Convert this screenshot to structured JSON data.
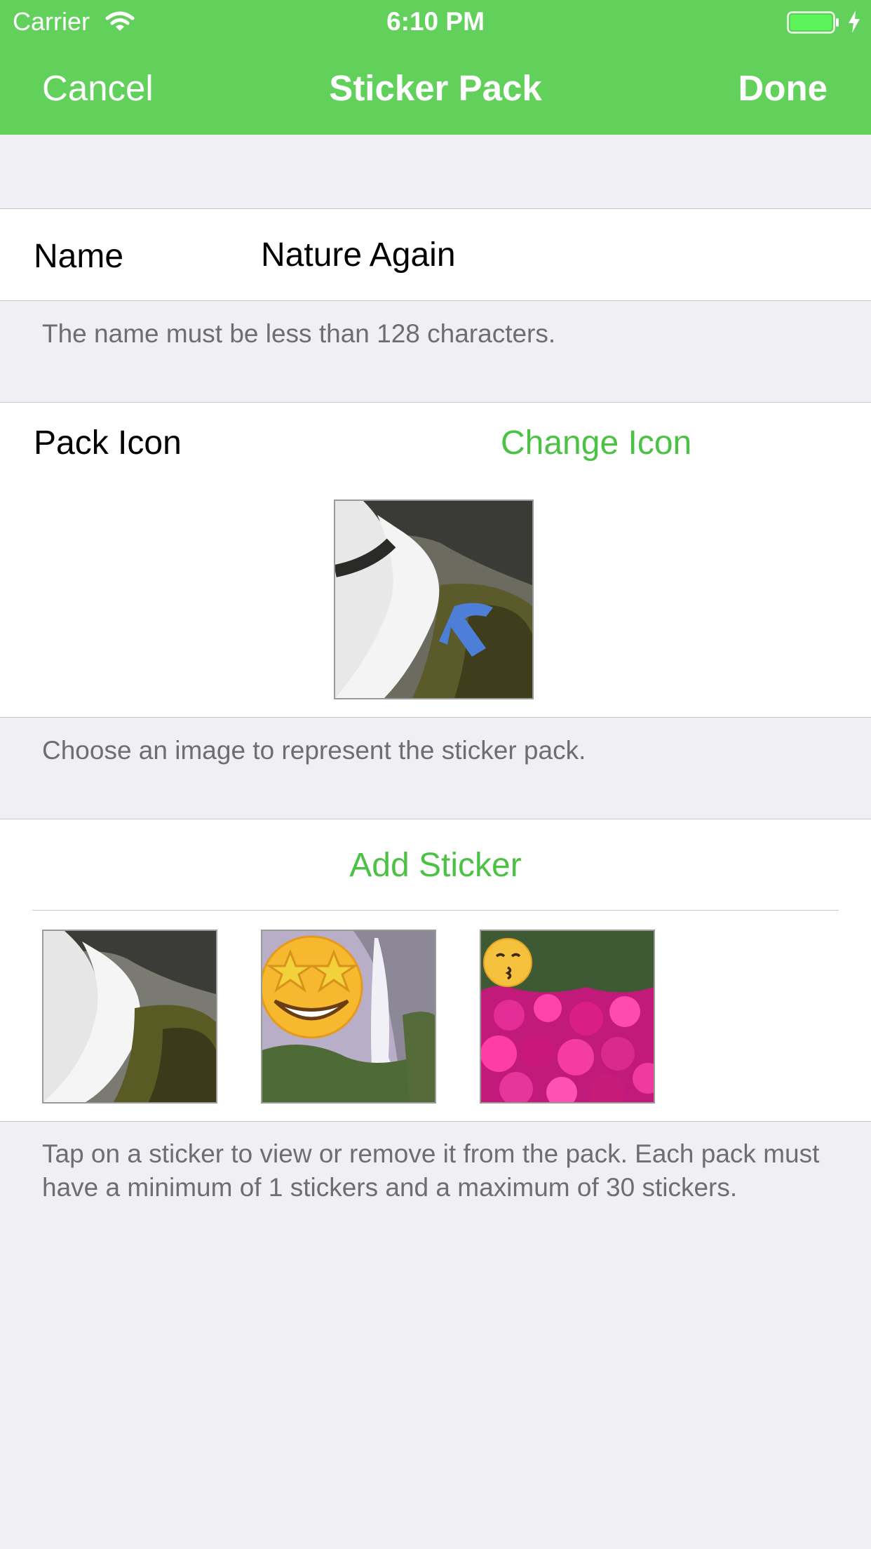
{
  "status_bar": {
    "carrier": "Carrier",
    "time": "6:10 PM"
  },
  "nav": {
    "cancel": "Cancel",
    "title": "Sticker Pack",
    "done": "Done"
  },
  "name_section": {
    "label": "Name",
    "value": "Nature Again",
    "footer": "The name must be less than 128 characters."
  },
  "icon_section": {
    "label": "Pack Icon",
    "change_button": "Change Icon",
    "footer": "Choose an image to represent the sticker pack."
  },
  "sticker_section": {
    "add_button": "Add Sticker",
    "stickers": [
      {
        "description": "waterfall-sticker"
      },
      {
        "description": "star-struck-waterfall-sticker"
      },
      {
        "description": "kissing-face-flowers-sticker"
      }
    ],
    "footer": "Tap on a sticker to view or remove it from the pack. Each pack must have a minimum of 1 stickers and a maximum of 30 stickers."
  },
  "colors": {
    "accent": "#62D15C",
    "link": "#4CC245",
    "background": "#EFEFF4"
  }
}
